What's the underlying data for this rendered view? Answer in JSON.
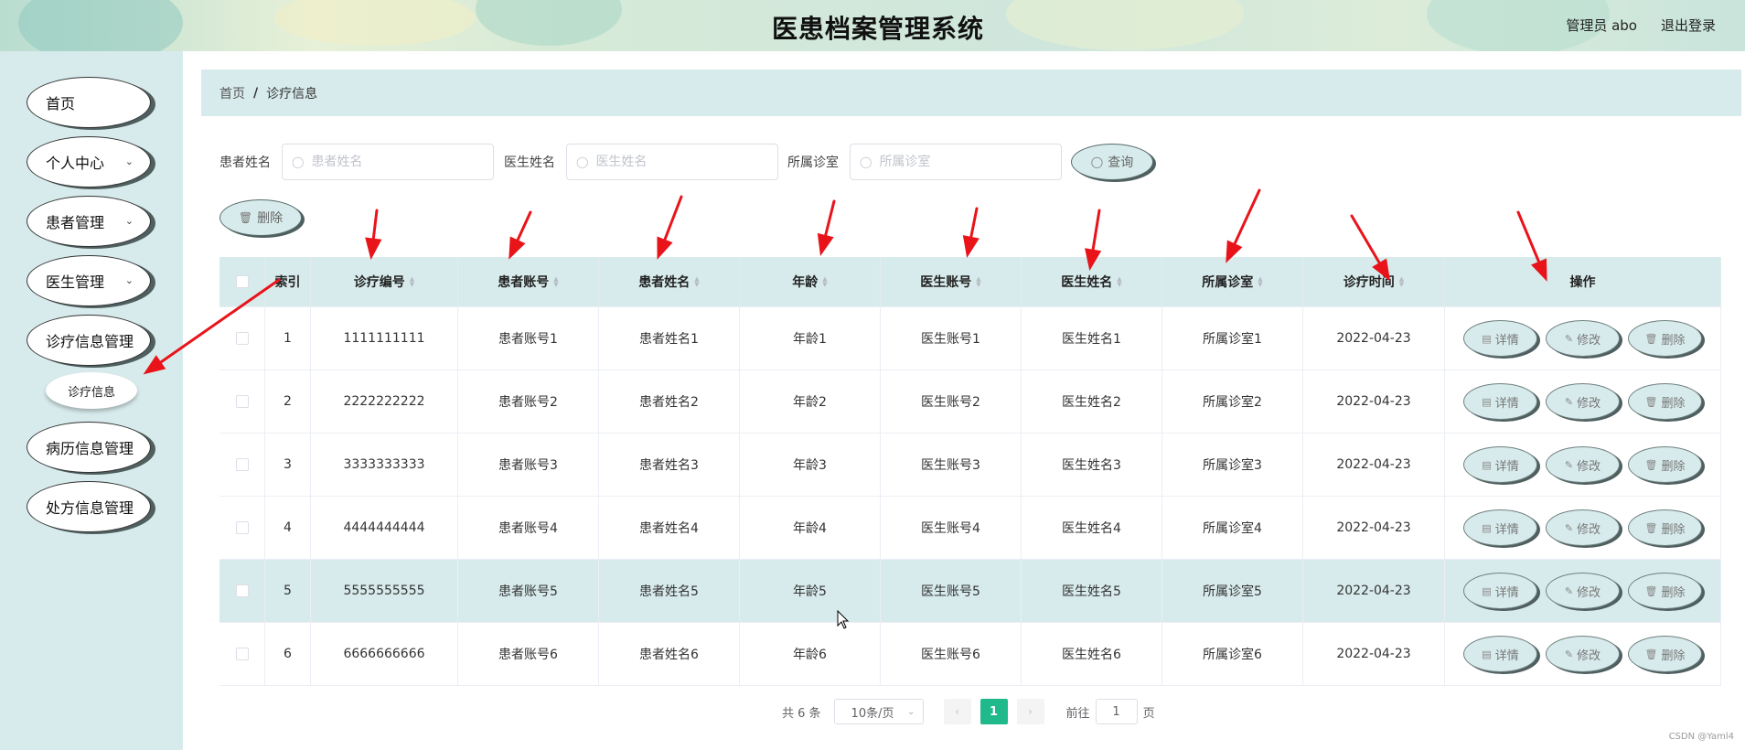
{
  "header": {
    "title": "医患档案管理系统",
    "user": "管理员 abo",
    "logout": "退出登录"
  },
  "sidebar": {
    "items": [
      {
        "label": "首页",
        "has_arrow": false
      },
      {
        "label": "个人中心",
        "has_arrow": true
      },
      {
        "label": "患者管理",
        "has_arrow": true
      },
      {
        "label": "医生管理",
        "has_arrow": true
      },
      {
        "label": "诊疗信息管理",
        "has_arrow": false
      },
      {
        "label": "病历信息管理",
        "has_arrow": false
      },
      {
        "label": "处方信息管理",
        "has_arrow": false
      }
    ],
    "submenu": {
      "label": "诊疗信息"
    },
    "chevron_icon": "chevron-down-icon"
  },
  "breadcrumb": {
    "home": "首页",
    "separator": "/",
    "current": "诊疗信息"
  },
  "search": {
    "patient_label": "患者姓名",
    "patient_placeholder": "患者姓名",
    "doctor_label": "医生姓名",
    "doctor_placeholder": "医生姓名",
    "clinic_label": "所属诊室",
    "clinic_placeholder": "所属诊室",
    "query_button": "查询"
  },
  "toolbar": {
    "delete_button": "删除"
  },
  "table": {
    "columns": [
      "索引",
      "诊疗编号",
      "患者账号",
      "患者姓名",
      "年龄",
      "医生账号",
      "医生姓名",
      "所属诊室",
      "诊疗时间",
      "操作"
    ],
    "rows": [
      {
        "index": "1",
        "code": "1111111111",
        "patient_account": "患者账号1",
        "patient_name": "患者姓名1",
        "age": "年龄1",
        "doctor_account": "医生账号1",
        "doctor_name": "医生姓名1",
        "clinic": "所属诊室1",
        "time": "2022-04-23"
      },
      {
        "index": "2",
        "code": "2222222222",
        "patient_account": "患者账号2",
        "patient_name": "患者姓名2",
        "age": "年龄2",
        "doctor_account": "医生账号2",
        "doctor_name": "医生姓名2",
        "clinic": "所属诊室2",
        "time": "2022-04-23"
      },
      {
        "index": "3",
        "code": "3333333333",
        "patient_account": "患者账号3",
        "patient_name": "患者姓名3",
        "age": "年龄3",
        "doctor_account": "医生账号3",
        "doctor_name": "医生姓名3",
        "clinic": "所属诊室3",
        "time": "2022-04-23"
      },
      {
        "index": "4",
        "code": "4444444444",
        "patient_account": "患者账号4",
        "patient_name": "患者姓名4",
        "age": "年龄4",
        "doctor_account": "医生账号4",
        "doctor_name": "医生姓名4",
        "clinic": "所属诊室4",
        "time": "2022-04-23"
      },
      {
        "index": "5",
        "code": "5555555555",
        "patient_account": "患者账号5",
        "patient_name": "患者姓名5",
        "age": "年龄5",
        "doctor_account": "医生账号5",
        "doctor_name": "医生姓名5",
        "clinic": "所属诊室5",
        "time": "2022-04-23"
      },
      {
        "index": "6",
        "code": "6666666666",
        "patient_account": "患者账号6",
        "patient_name": "患者姓名6",
        "age": "年龄6",
        "doctor_account": "医生账号6",
        "doctor_name": "医生姓名6",
        "clinic": "所属诊室6",
        "time": "2022-04-23"
      }
    ],
    "actions": {
      "detail": "详情",
      "edit": "修改",
      "delete": "删除"
    },
    "highlighted_row": 5
  },
  "pagination": {
    "total": "共 6 条",
    "page_size": "10条/页",
    "current_page": "1",
    "goto_prefix": "前往",
    "goto_value": "1",
    "goto_suffix": "页"
  },
  "watermark": "CSDN @Yaml4",
  "colors": {
    "accent": "#1fb98c",
    "panel": "#d8ebec",
    "annotation_arrow": "#e8141a"
  }
}
